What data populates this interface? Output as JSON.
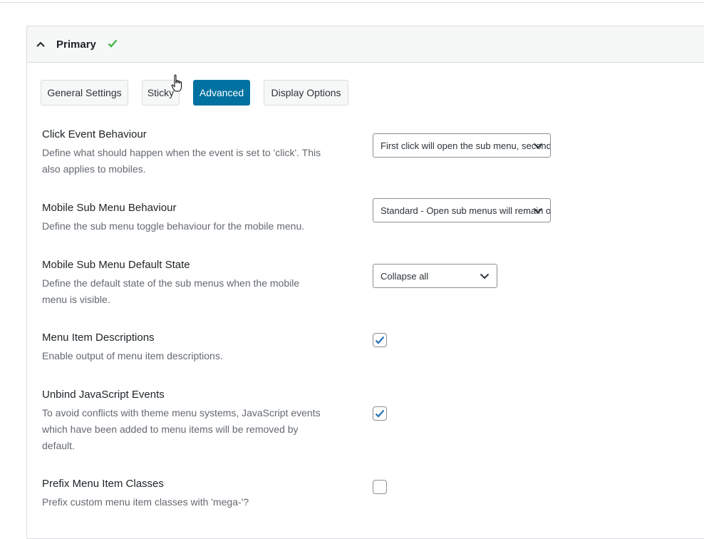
{
  "panel": {
    "title": "Primary"
  },
  "tabs": [
    {
      "label": "General Settings",
      "active": false
    },
    {
      "label": "Sticky",
      "active": false
    },
    {
      "label": "Advanced",
      "active": true
    },
    {
      "label": "Display Options",
      "active": false
    }
  ],
  "settings": {
    "click_event": {
      "title": "Click Event Behaviour",
      "desc_line1": "Define what should happen when the event is set to 'click'. This",
      "desc_line2": "also applies to mobiles.",
      "value": "First click will open the sub menu, second click will close the sub menu."
    },
    "mobile_sub_menu": {
      "title": "Mobile Sub Menu Behaviour",
      "desc_line1": "Define the sub menu toggle behaviour for the mobile menu.",
      "value": "Standard - Open sub menus will remain open"
    },
    "mobile_default_state": {
      "title": "Mobile Sub Menu Default State",
      "desc_line1": "Define the default state of the sub menus when the mobile",
      "desc_line2": "menu is visible.",
      "value": "Collapse all"
    },
    "descriptions": {
      "title": "Menu Item Descriptions",
      "desc_line1": "Enable output of menu item descriptions.",
      "checked": true
    },
    "unbind_js": {
      "title": "Unbind JavaScript Events",
      "desc_line1": "To avoid conflicts with theme menu systems, JavaScript events",
      "desc_line2": "which have been added to menu items will be removed by",
      "desc_line3": "default.",
      "checked": true
    },
    "prefix_classes": {
      "title": "Prefix Menu Item Classes",
      "desc_line1": "Prefix custom menu item classes with 'mega-'?",
      "checked": false
    }
  },
  "colors": {
    "accent": "#0071a1",
    "check_green": "#46b450"
  }
}
